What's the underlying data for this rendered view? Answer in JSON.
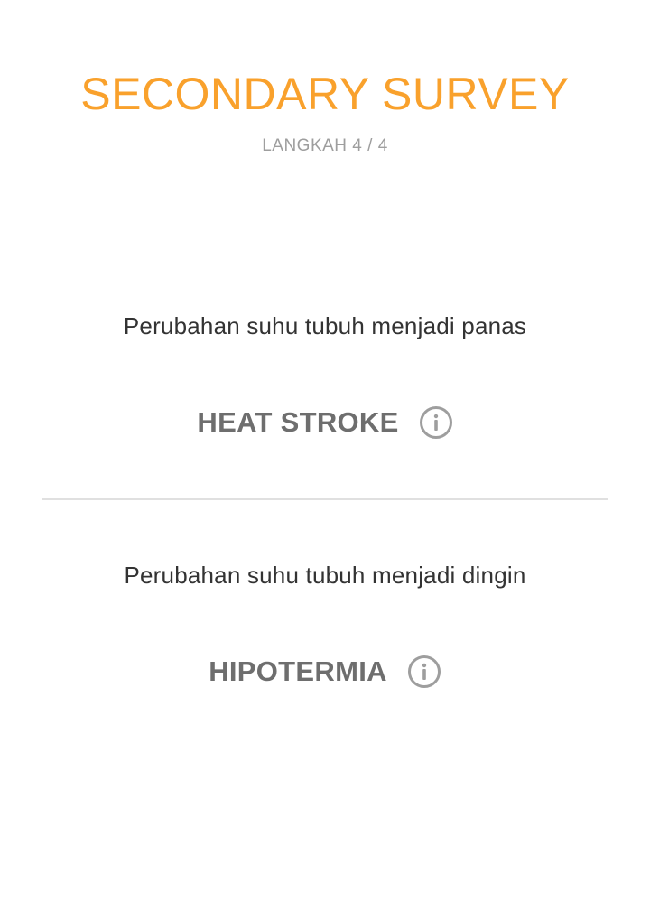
{
  "header": {
    "title": "SECONDARY SURVEY",
    "step": "LANGKAH 4 / 4"
  },
  "items": [
    {
      "question": "Perubahan suhu tubuh menjadi panas",
      "answer": "HEAT STROKE",
      "icon": "info-icon"
    },
    {
      "question": "Perubahan suhu tubuh menjadi dingin",
      "answer": "HIPOTERMIA",
      "icon": "info-icon"
    }
  ],
  "colors": {
    "accent": "#F9A12C",
    "answer_text": "#6E6E6E",
    "icon": "#9E9E9E",
    "divider": "#E0E0E0"
  }
}
